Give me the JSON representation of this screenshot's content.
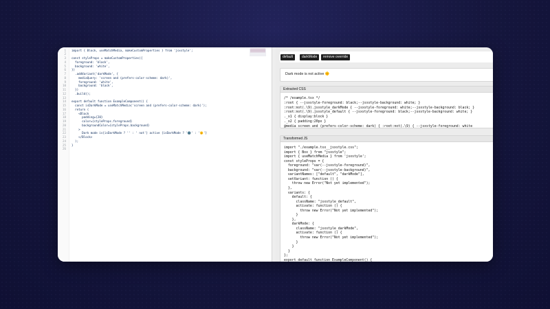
{
  "editor": {
    "line_numbers": [
      "1",
      "2",
      "3",
      "4",
      "5",
      "6",
      "7",
      "8",
      "9",
      "10",
      "11",
      "12",
      "13",
      "14",
      "15",
      "16",
      "17",
      "18",
      "19",
      "20",
      "21",
      "22",
      "23",
      "24",
      "25",
      "26"
    ],
    "code_lines": [
      "import { Block, useMatchMedia, makeCustomProperties } from 'jsxstyle';",
      "",
      "const styleProps = makeCustomProperties({",
      "  foreground: 'black',",
      "  background: 'white',",
      "})",
      "  .addVariant('darkMode', {",
      "    mediaQuery: 'screen and (prefers-color-scheme: dark)',",
      "    foreground: 'white',",
      "    background: 'black',",
      "  })",
      "  .build();",
      "",
      "export default function ExampleComponent() {",
      "  const isDarkMode = useMatchMedia('screen and (prefers-color-scheme: dark)');",
      "  return (",
      "    <Block",
      "      padding={20}",
      "      color={styleProps.foreground}",
      "      backgroundColor={styleProps.background}",
      "    >",
      "      Dark mode is{isDarkMode ? '' : ' not'} active {isDarkMode ? '🌚' : '🌞'}",
      "    </Block>",
      "  );",
      "}",
      ""
    ]
  },
  "toolbar": {
    "buttons": [
      "default",
      "darkMode",
      "remove override"
    ]
  },
  "preview": {
    "status_text": "Dark mode is not active 🌞"
  },
  "extracted_css": {
    "title": "Extracted CSS",
    "lines": [
      "/* /example.tsx */",
      ":root { --jsxstyle-foreground: black;--jsxstyle-background: white; }",
      ":root:not(.\\9).jsxstyle_darkMode { --jsxstyle-foreground: white;--jsxstyle-background: black; }",
      ":root:not(.\\9).jsxstyle_default { --jsxstyle-foreground: black;--jsxstyle-background: white; }",
      "._x1 { display:block }",
      "._x2 { padding:20px }",
      "@media screen and (prefers-color-scheme: dark) { :root:not(.\\9) { --jsxstyle-foreground: white"
    ]
  },
  "transformed_js": {
    "title": "Transformed JS",
    "lines": [
      "import \"./example.tsx__jsxstyle.css\";",
      "import { Box } from \"jsxstyle\";",
      "import { useMatchMedia } from 'jsxstyle';",
      "const styleProps = {",
      "  foreground: \"var(--jsxstyle-foreground)\",",
      "  background: \"var(--jsxstyle-background)\",",
      "  variantNames: [\"default\", \"darkMode\"],",
      "  setVariant: function () {",
      "    throw new Error(\"Not yet implemented\");",
      "  },",
      "  variants: {",
      "    default: {",
      "      className: \"jsxstyle_default\",",
      "      activate: function () {",
      "        throw new Error(\"Not yet implemented\");",
      "      }",
      "    },",
      "    darkMode: {",
      "      className: \"jsxstyle_darkMode\",",
      "      activate: function () {",
      "        throw new Error(\"Not yet implemented\");",
      "      }",
      "    }",
      "  }",
      "};",
      "export default function ExampleComponent() {"
    ]
  }
}
